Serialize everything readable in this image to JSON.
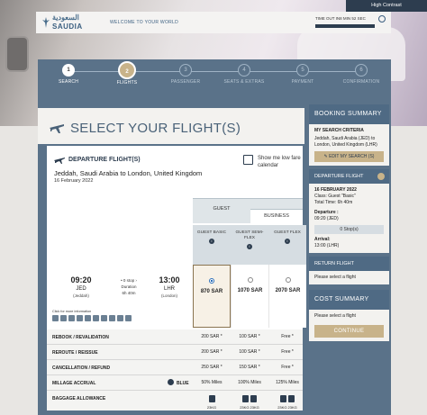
{
  "header": {
    "high_contrast": "High Contrast",
    "logo_ar": "السعودية",
    "logo_en": "SAUDIA",
    "welcome": "WELCOME TO YOUR WORLD",
    "timeout": "TIME OUT IN8 MIN 52 SEC"
  },
  "steps": [
    {
      "num": "1",
      "label": "SEARCH"
    },
    {
      "num": "2",
      "label": "FLIGHTS"
    },
    {
      "num": "3",
      "label": "PASSENGER"
    },
    {
      "num": "4",
      "label": "SEATS & EXTRAS"
    },
    {
      "num": "5",
      "label": "PAYMENT"
    },
    {
      "num": "6",
      "label": "CONFIRMATION"
    }
  ],
  "main": {
    "title": "SELECT YOUR FLIGHT(S)",
    "departure_title": "DEPARTURE FLIGHT(S)",
    "route": "Jeddah, Saudi Arabia to London, United Kingdom",
    "date": "16 February 2022",
    "calendar_link": "Show me low fare calendar",
    "guest_label": "GUEST",
    "business_label": "BUSINESS",
    "fares": [
      "GUEST BASIC",
      "GUEST SEMI-FLEX",
      "GUEST FLEX"
    ],
    "info_glyph": "i"
  },
  "flight": {
    "dep_time": "09:20",
    "dep_code": "JED",
    "dep_city": "(Jeddah)",
    "stops": "0 stop",
    "duration_label": "Duration",
    "duration": "6h 40m",
    "arr_time": "13:00",
    "arr_code": "LHR",
    "arr_city": "(London)",
    "more_info": "Click for more information",
    "prices": [
      "870 SAR",
      "1070 SAR",
      "2070 SAR"
    ]
  },
  "rules": [
    {
      "label": "REBOOK / REVALIDATION",
      "values": [
        "200 SAR *",
        "100 SAR *",
        "Free *"
      ]
    },
    {
      "label": "REROUTE / REISSUE",
      "values": [
        "200 SAR *",
        "100 SAR *",
        "Free *"
      ]
    },
    {
      "label": "CANCELLATION / REFUND",
      "values": [
        "250 SAR *",
        "150 SAR *",
        "Free *"
      ]
    },
    {
      "label": "MILLAGE ACCRUAL",
      "tier": "BLUE",
      "values": [
        "50% Miles",
        "100% Miles",
        "125% Miles"
      ]
    },
    {
      "label": "BAGGAGE ALLOWANCE",
      "values": [
        "23KG",
        "23KG 23KG",
        "23KG 23KG"
      ]
    }
  ],
  "summary": {
    "title": "BOOKING SUMMARY",
    "criteria_title": "MY SEARCH CRITERIA",
    "criteria_route": "Jeddah, Saudi Arabia (JED) to London, United Kingdom (LHR)",
    "edit_label": "EDIT MY SEARCH (S)",
    "departure_head": "DEPARTURE FLIGHT",
    "dep_date": "16 FEBRUARY 2022",
    "dep_class": "Class: Guest \"Basic\"",
    "dep_total": "Total Time: 6h 40m",
    "departure_label": "Departure :",
    "departure_val": "09:20 (JED)",
    "stops_val": "0 Stop(s)",
    "arrival_label": "Arrival:",
    "arrival_val": "13:00 (LHR)",
    "return_head": "RETURN FLIGHT",
    "return_msg": "Please select a flight",
    "cost_title": "COST SUMMARY",
    "cost_msg": "Please select a flight",
    "continue": "CONTINUE"
  },
  "colors": {
    "brand_dark": "#2d3d4f",
    "brand_slate": "#5a7289",
    "accent_gold": "#c8b38a"
  }
}
